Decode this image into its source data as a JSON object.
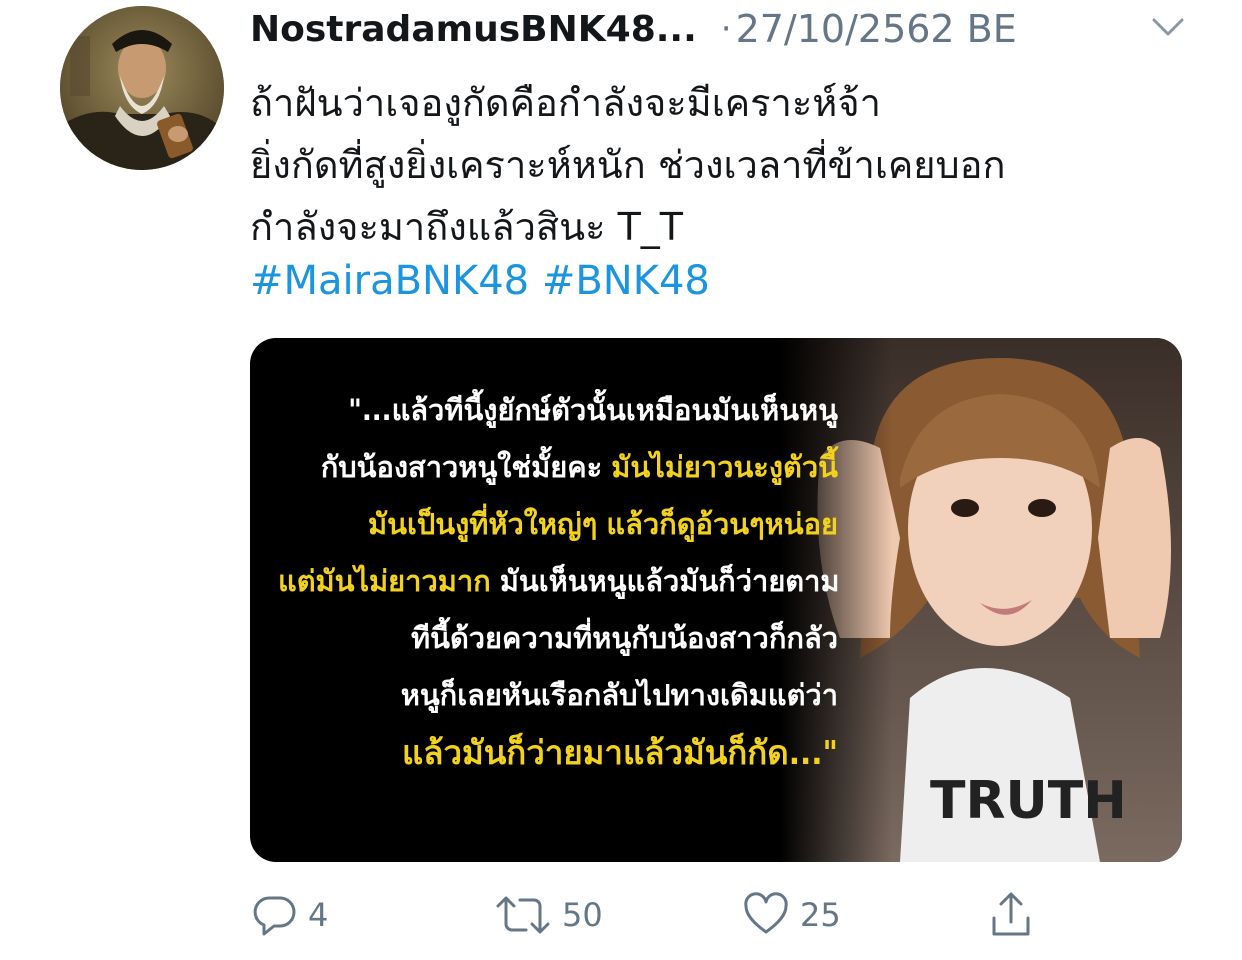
{
  "tweet": {
    "author_name": "NostradamusBNK48...",
    "separator": "·",
    "date": "27/10/2562 BE",
    "text_lines": [
      "ถ้าฝันว่าเจองูกัดคือกำลังจะมีเคราะห์จ้า",
      "ยิ่งกัดที่สูงยิ่งเคราะห์หนัก ช่วงเวลาที่ข้าเคยบอก",
      "กำลังจะมาถึงแล้วสินะ T_T"
    ],
    "hashtags": [
      "#MairaBNK48",
      "#BNK48"
    ]
  },
  "media": {
    "quote": {
      "line1": "\"...แล้วทีนี้งูยักษ์ตัวนั้นเหมือนมันเห็นหนู",
      "line2a": "กับน้องสาวหนูใช่มั้ยคะ ",
      "line2b": "มันไม่ยาวนะงูตัวนี้",
      "line3": "มันเป็นงูที่หัวใหญ่ๆ แล้วก็ดูอ้วนๆหน่อย",
      "line4a": "แต่มันไม่ยาวมาก ",
      "line4b": "มันเห็นหนูแล้วมันก็ว่ายตาม",
      "line5": "ทีนี้ด้วยความที่หนูกับน้องสาวก็กลัว",
      "line6": "หนูก็เลยหันเรือกลับไปทางเดิมแต่ว่า",
      "line7": "แล้วมันก็ว่ายมาแล้วมันก็กัด...\""
    },
    "shirt_text": "TRUTH",
    "highlight_color": "#f2d21c"
  },
  "actions": {
    "reply_count": "4",
    "retweet_count": "50",
    "like_count": "25"
  },
  "icons": [
    "reply-icon",
    "retweet-icon",
    "like-icon",
    "share-icon",
    "chevron-down-icon"
  ],
  "colors": {
    "name": "#14171a",
    "meta": "#657786",
    "hashtag": "#1b95e0"
  }
}
